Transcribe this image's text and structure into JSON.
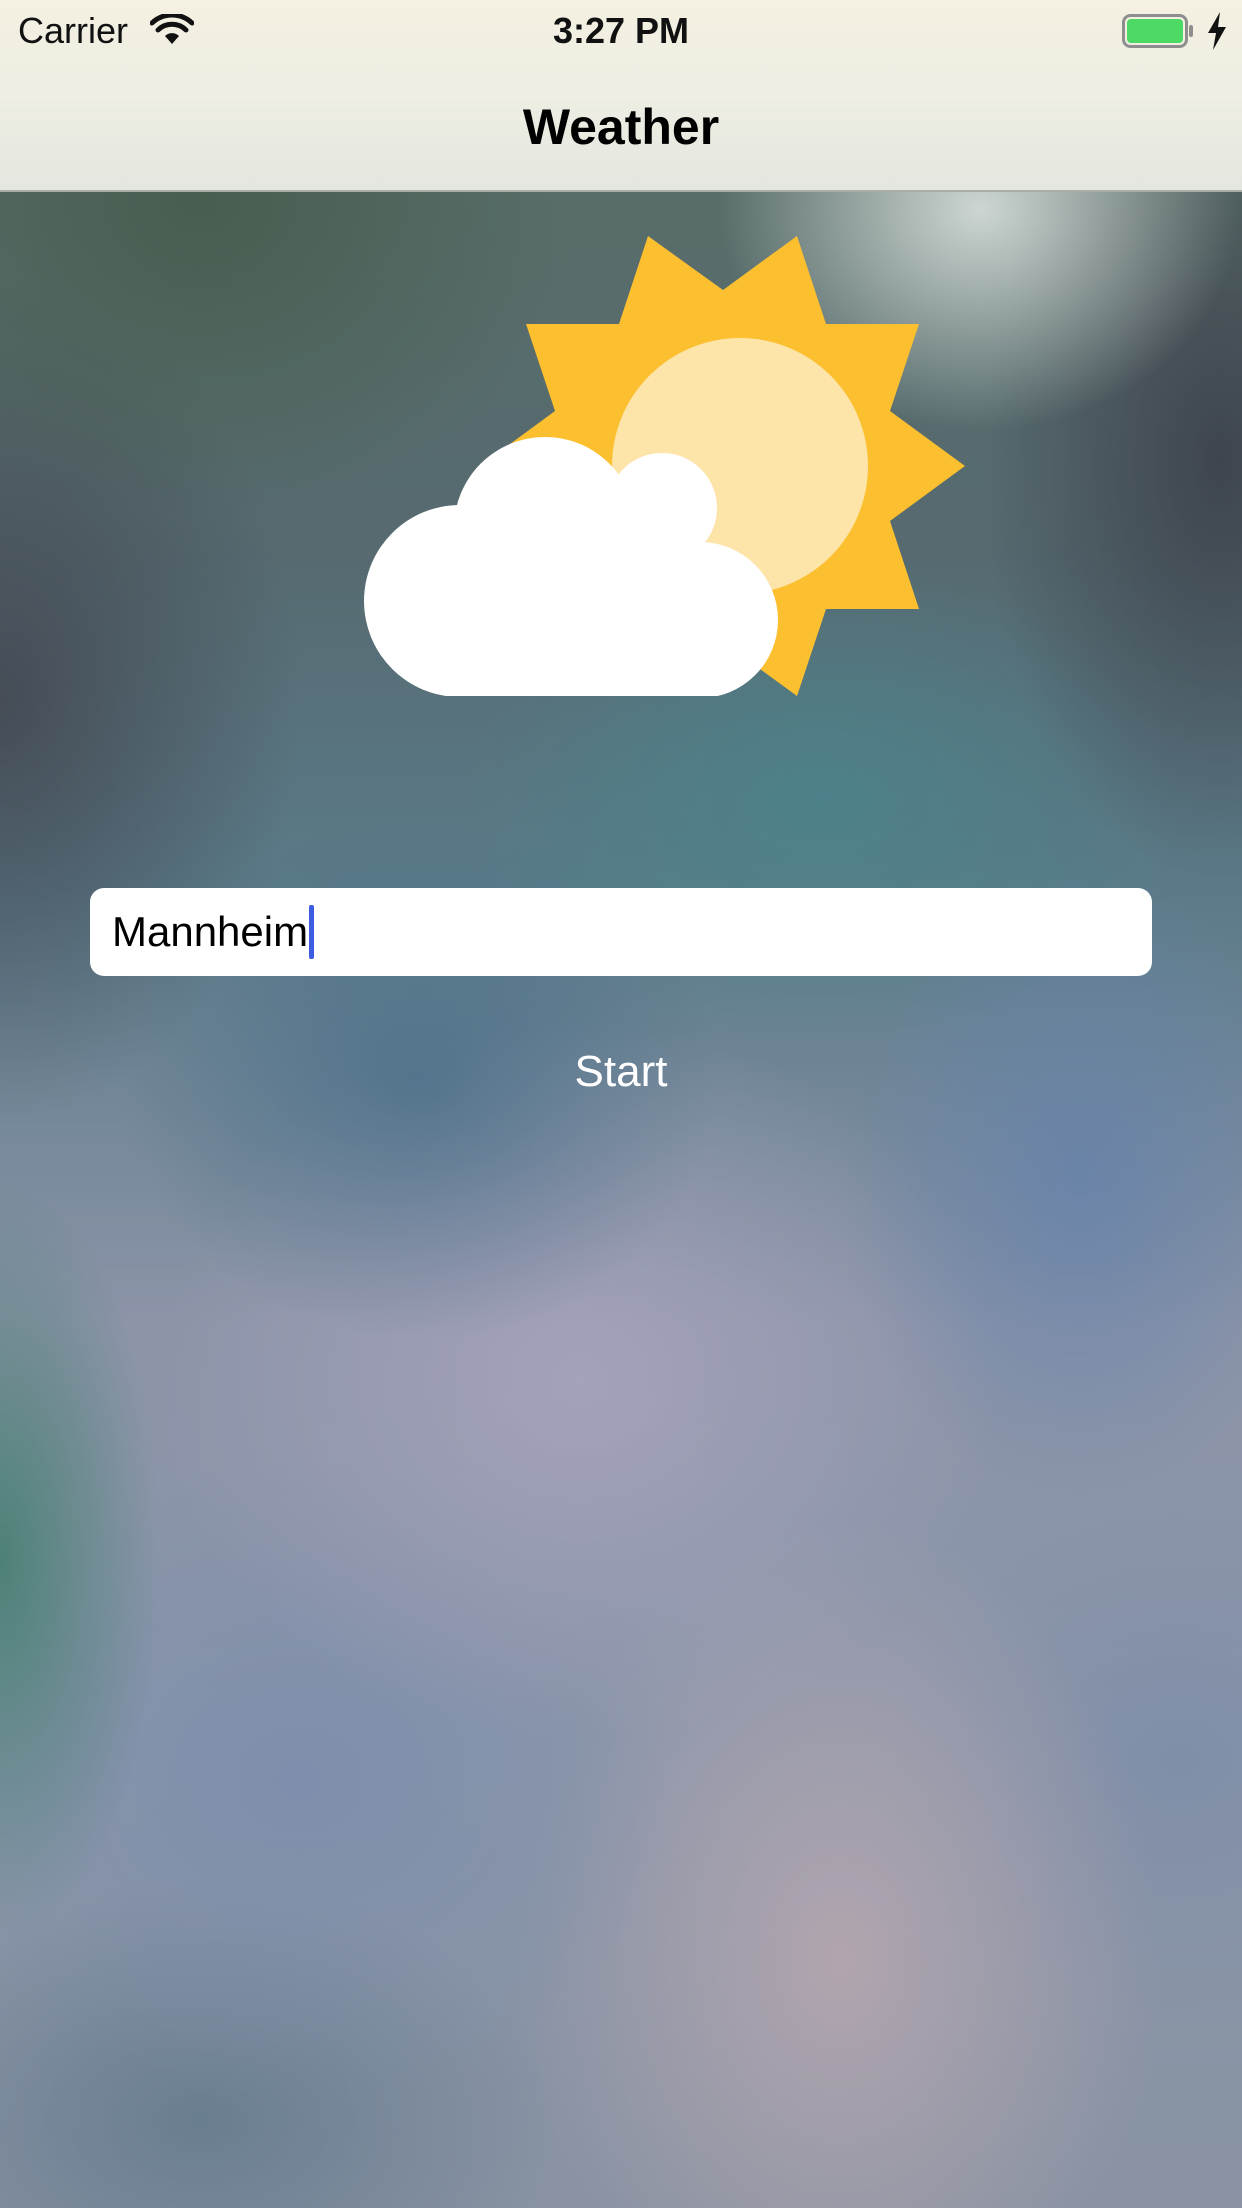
{
  "status_bar": {
    "carrier": "Carrier",
    "time": "3:27 PM",
    "icons": [
      "wifi-icon",
      "battery-icon",
      "charging-icon"
    ]
  },
  "nav": {
    "title": "Weather"
  },
  "illustration": {
    "icon": "partly-cloudy-icon",
    "colors": {
      "sun_rays": "#fbbf2f",
      "sun_core": "#fde4a8",
      "cloud": "#ffffff"
    }
  },
  "form": {
    "city_value": "Mannheim",
    "start_label": "Start"
  },
  "colors": {
    "cursor": "#3d5ee0",
    "battery": "#4cd964"
  }
}
